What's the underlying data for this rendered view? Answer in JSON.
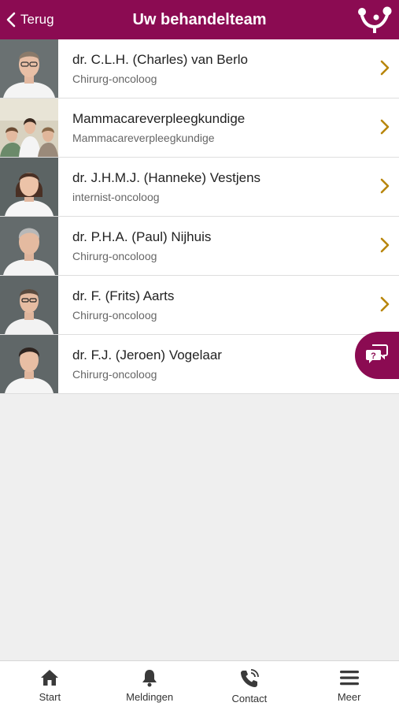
{
  "header": {
    "back_label": "Terug",
    "title": "Uw behandelteam",
    "logo_icon": "patient-journey-logo"
  },
  "team": [
    {
      "name": "dr. C.L.H. (Charles) van Berlo",
      "role": "Chirurg-oncoloog",
      "has_detail": true
    },
    {
      "name": "Mammacareverpleegkundige",
      "role": "Mammacareverpleegkundige",
      "has_detail": true
    },
    {
      "name": "dr. J.H.M.J. (Hanneke) Vestjens",
      "role": "internist-oncoloog",
      "has_detail": true
    },
    {
      "name": "dr. P.H.A. (Paul) Nijhuis",
      "role": "Chirurg-oncoloog",
      "has_detail": true
    },
    {
      "name": "dr. F. (Frits) Aarts",
      "role": "Chirurg-oncoloog",
      "has_detail": true
    },
    {
      "name": "dr. F.J. (Jeroen) Vogelaar",
      "role": "Chirurg-oncoloog",
      "has_detail": false
    }
  ],
  "tabbar": {
    "start": "Start",
    "meldingen": "Meldingen",
    "contact": "Contact",
    "meer": "Meer"
  },
  "colors": {
    "brand": "#8b0b52",
    "chevron": "#b8860b",
    "background": "#efefef"
  }
}
